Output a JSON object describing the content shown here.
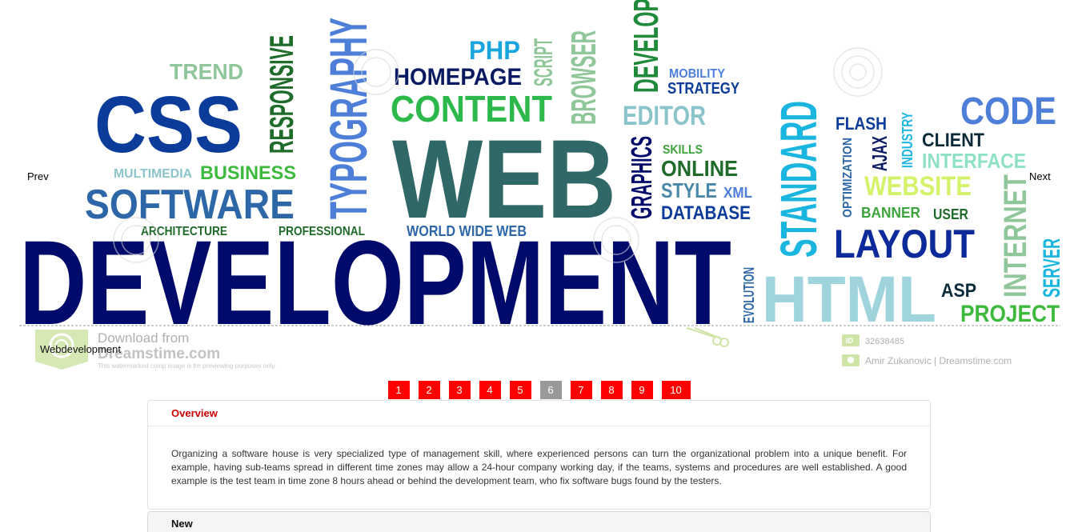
{
  "slider": {
    "prev_label": "Prev",
    "next_label": "Next",
    "caption": "Webdevelopment",
    "image": {
      "words": {
        "development": "DEVELOPMENT",
        "web": "WEB",
        "css": "CSS",
        "software": "SOFTWARE",
        "content": "CONTENT",
        "homepage": "HOMEPAGE",
        "php": "PHP",
        "typography": "TYPOGRAPHY",
        "responsive": "RESPONSIVE",
        "trend": "TREND",
        "multimedia": "MULTIMEDIA",
        "business": "BUSINESS",
        "architecture": "ARCHITECTURE",
        "professional": "PROFESSIONAL",
        "world_wide_web": "WORLD WIDE WEB",
        "script": "SCRIPT",
        "browser": "BROWSER",
        "develop": "DEVELOP",
        "mobility": "MOBILITY",
        "strategy": "STRATEGY",
        "editor": "EDITOR",
        "graphics": "GRAPHICS",
        "skills": "SKILLS",
        "online": "ONLINE",
        "style": "STYLE",
        "xml": "XML",
        "database": "DATABASE",
        "standard": "STANDARD",
        "flash": "FLASH",
        "optimization": "OPTIMIZATION",
        "ajax": "AJAX",
        "industry": "INDUSTRY",
        "client": "CLIENT",
        "interface": "INTERFACE",
        "code": "CODE",
        "website": "WEBSITE",
        "banner": "BANNER",
        "user": "USER",
        "layout": "LAYOUT",
        "internet": "INTERNET",
        "server": "SERVER",
        "evolution": "EVOLUTION",
        "html": "HTML",
        "asp": "ASP",
        "project": "PROJECT"
      },
      "watermark": {
        "download_from": "Download from",
        "brand": "Dreamstime.com",
        "notice": "This watermarked comp image is for previewing purposes only.",
        "id_label": "ID",
        "id_value": "32638485",
        "credit": "Amir Zukanovic | Dreamstime.com"
      }
    }
  },
  "pager": {
    "pages": [
      "1",
      "2",
      "3",
      "4",
      "5",
      "6",
      "7",
      "8",
      "9",
      "10"
    ],
    "active_index": 5,
    "colors": {
      "default": "#ff0000",
      "active": "#999999"
    }
  },
  "overview": {
    "title": "Overview",
    "body": "Organizing a software house is very specialized type of management skill, where experienced persons can turn the organizational problem into a unique benefit. For example, having sub-teams spread in different time zones may allow a 24-hour company working day, if the teams, systems and procedures are well established. A good example is the test team in time zone 8 hours ahead or behind the development team, who fix software bugs found by the testers."
  },
  "new_panel": {
    "title": "New"
  }
}
